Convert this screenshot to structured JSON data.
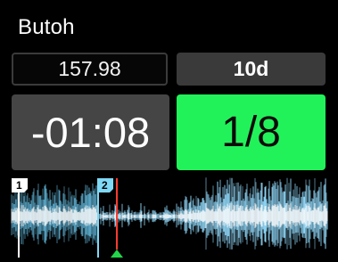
{
  "deck": {
    "title": "Butoh",
    "bpm": "157.98",
    "beatjump": "10d",
    "time_remaining": "-01:08",
    "loop_size": "1/8"
  },
  "waveform": {
    "cue_points": [
      {
        "label": "1",
        "color": "#ffffff"
      },
      {
        "label": "2",
        "color": "#7fd8f5"
      }
    ],
    "playhead_color": "#ff3b2f",
    "wave_color": "#8fd6f7"
  },
  "colors": {
    "background": "#000000",
    "loop_active": "#22f25a",
    "panel": "#454545"
  }
}
